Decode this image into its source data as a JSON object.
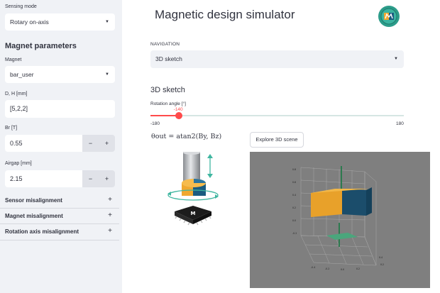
{
  "sidebar": {
    "sensing_mode_label": "Sensing mode",
    "sensing_mode_value": "Rotary on-axis",
    "section_title": "Magnet parameters",
    "magnet_label": "Magnet",
    "magnet_value": "bar_user",
    "dh_label": "D, H [mm]",
    "dh_value": "[5,2,2]",
    "br_label": "Br [T]",
    "br_value": "0.55",
    "airgap_label": "Airgap [mm]",
    "airgap_value": "2.15",
    "minus": "−",
    "plus": "+",
    "expanders": [
      {
        "label": "Sensor misalignment",
        "icon": "+"
      },
      {
        "label": "Magnet misalignment",
        "icon": "+"
      },
      {
        "label": "Rotation axis misalignment",
        "icon": "+"
      }
    ]
  },
  "main": {
    "title": "Magnetic design simulator",
    "nav_label": "NAVIGATION",
    "nav_value": "3D sketch",
    "section_heading": "3D sketch",
    "slider": {
      "label": "Rotation angle [°]",
      "value": -140,
      "value_text": "-140",
      "min": -180,
      "min_text": "-180",
      "max": 180,
      "max_text": "180"
    },
    "formula": "θout = atan2(By, Bz)",
    "explore_button": "Explore 3D scene",
    "caret": "▼"
  },
  "colors": {
    "accent": "#ff4b4b",
    "sidebar_bg": "#f0f2f6",
    "scene_bg": "#7f7f7f",
    "magnet_orange": "#f0a830",
    "magnet_blue": "#1a5b80",
    "sensor_green": "#5fa98a"
  },
  "icons": {
    "logo": "magnet-logo-icon",
    "select_caret": "caret-down-icon",
    "expander": "plus-icon"
  }
}
